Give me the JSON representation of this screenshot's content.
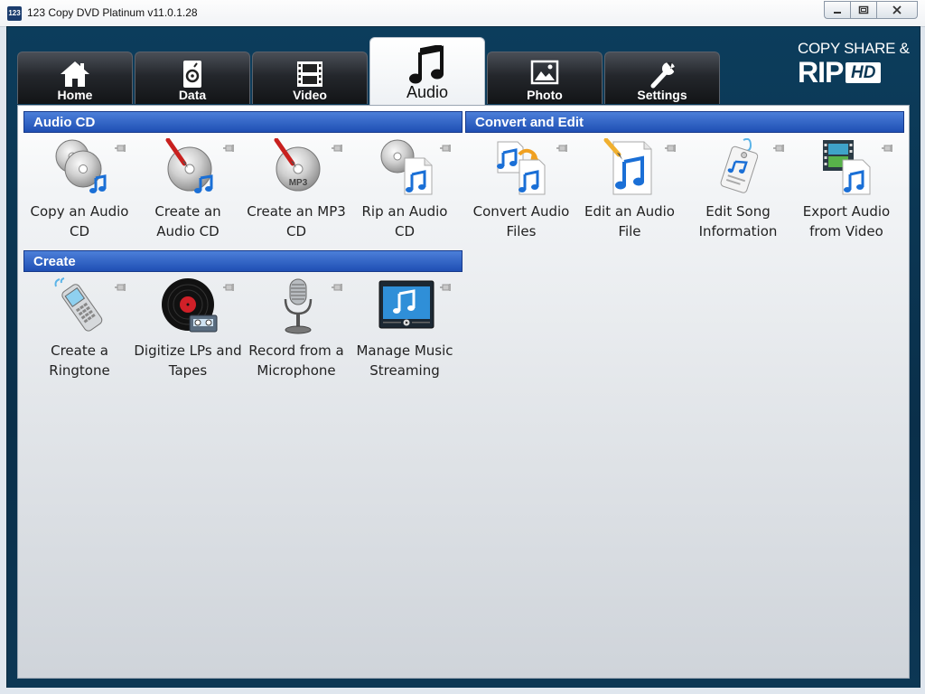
{
  "window": {
    "title": "123 Copy DVD Platinum v11.0.1.28",
    "app_icon_text": "123",
    "controls": [
      "minimize",
      "maximize",
      "close"
    ]
  },
  "tabs": [
    {
      "label": "Home",
      "icon": "home-icon",
      "active": false
    },
    {
      "label": "Data",
      "icon": "data-icon",
      "active": false
    },
    {
      "label": "Video",
      "icon": "film-icon",
      "active": false
    },
    {
      "label": "Audio",
      "icon": "music-note-icon",
      "active": true
    },
    {
      "label": "Photo",
      "icon": "image-icon",
      "active": false
    },
    {
      "label": "Settings",
      "icon": "wrench-icon",
      "active": false
    }
  ],
  "logo": {
    "line1": "COPY SHARE &",
    "rip": "RIP",
    "hd": "HD"
  },
  "sections": {
    "audio_cd": {
      "title": "Audio CD",
      "items": [
        {
          "label": "Copy an Audio CD",
          "icon": "copy-audio-cd-icon"
        },
        {
          "label": "Create an Audio CD",
          "icon": "create-audio-cd-icon"
        },
        {
          "label": "Create an MP3 CD",
          "icon": "create-mp3-cd-icon",
          "disc_text": "MP3"
        },
        {
          "label": "Rip an Audio CD",
          "icon": "rip-audio-cd-icon"
        }
      ]
    },
    "convert_edit": {
      "title": "Convert and Edit",
      "items": [
        {
          "label": "Convert Audio Files",
          "icon": "convert-audio-icon"
        },
        {
          "label": "Edit an Audio File",
          "icon": "edit-audio-icon"
        },
        {
          "label": "Edit Song Information",
          "icon": "song-tag-icon"
        },
        {
          "label": "Export Audio from Video",
          "icon": "export-audio-video-icon"
        }
      ]
    },
    "create": {
      "title": "Create",
      "items": [
        {
          "label": "Create a Ringtone",
          "icon": "phone-icon"
        },
        {
          "label": "Digitize LPs and Tapes",
          "icon": "vinyl-icon"
        },
        {
          "label": "Record from a Microphone",
          "icon": "microphone-icon"
        },
        {
          "label": "Manage Music Streaming",
          "icon": "streaming-icon"
        }
      ]
    }
  },
  "colors": {
    "frame": "#0c3d5c",
    "section_header": "#2a5ec4",
    "note_blue": "#1a6fd6"
  }
}
